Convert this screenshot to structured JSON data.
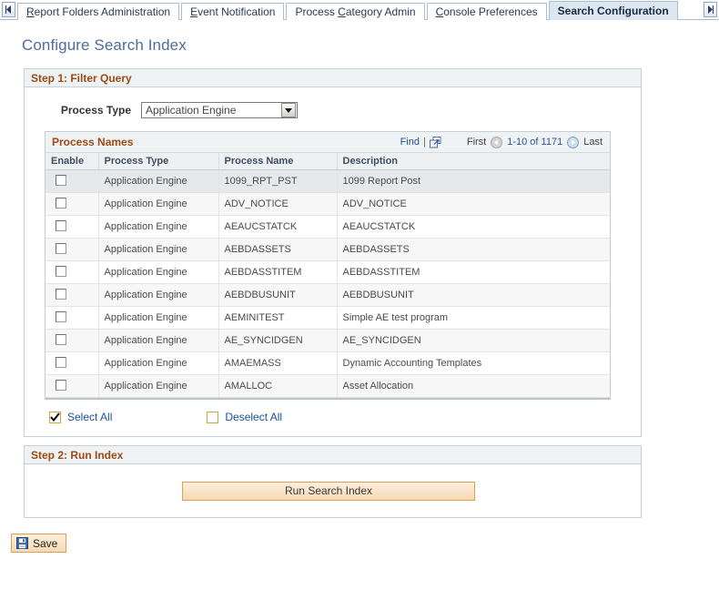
{
  "tabs": {
    "scroll_left_icon": "scroll-left-icon",
    "scroll_right_icon": "scroll-right-icon",
    "items": [
      {
        "label": "Report Folders Administration",
        "accel": "R",
        "active": false
      },
      {
        "label": "Event Notification",
        "accel": "E",
        "active": false
      },
      {
        "label": "Process Category Admin",
        "accel": "C",
        "active": false
      },
      {
        "label": "Console Preferences",
        "accel": "C",
        "active": false
      },
      {
        "label": "Search Configuration",
        "accel": "",
        "active": true
      }
    ]
  },
  "page": {
    "title": "Configure Search Index"
  },
  "step1": {
    "header": "Step 1: Filter Query",
    "process_type_label": "Process Type",
    "process_type_value": "Application Engine",
    "dropdown_icon": "chevron-down-icon"
  },
  "grid": {
    "title": "Process Names",
    "find_label": "Find",
    "separator": "|",
    "expand_icon": "view-all-expand-icon",
    "first_label": "First",
    "prev_icon": "prev-arrow-icon",
    "range_label": "1-10 of 1171",
    "next_icon": "next-arrow-icon",
    "last_label": "Last",
    "columns": [
      "Enable",
      "Process Type",
      "Process Name",
      "Description"
    ],
    "rows": [
      {
        "enabled": false,
        "process_type": "Application Engine",
        "process_name": "1099_RPT_PST",
        "description": "1099 Report Post"
      },
      {
        "enabled": false,
        "process_type": "Application Engine",
        "process_name": "ADV_NOTICE",
        "description": "ADV_NOTICE"
      },
      {
        "enabled": false,
        "process_type": "Application Engine",
        "process_name": "AEAUCSTATCK",
        "description": "AEAUCSTATCK"
      },
      {
        "enabled": false,
        "process_type": "Application Engine",
        "process_name": "AEBDASSETS",
        "description": "AEBDASSETS"
      },
      {
        "enabled": false,
        "process_type": "Application Engine",
        "process_name": "AEBDASSTITEM",
        "description": "AEBDASSTITEM"
      },
      {
        "enabled": false,
        "process_type": "Application Engine",
        "process_name": "AEBDBUSUNIT",
        "description": "AEBDBUSUNIT"
      },
      {
        "enabled": false,
        "process_type": "Application Engine",
        "process_name": "AEMINITEST",
        "description": "Simple AE test program"
      },
      {
        "enabled": false,
        "process_type": "Application Engine",
        "process_name": "AE_SYNCIDGEN",
        "description": "AE_SYNCIDGEN"
      },
      {
        "enabled": false,
        "process_type": "Application Engine",
        "process_name": "AMAEMASS",
        "description": "Dynamic Accounting Templates"
      },
      {
        "enabled": false,
        "process_type": "Application Engine",
        "process_name": "AMALLOC",
        "description": "Asset Allocation"
      }
    ]
  },
  "select_actions": {
    "select_all_label": "Select All",
    "select_all_checked": true,
    "deselect_all_label": "Deselect All",
    "deselect_all_checked": false
  },
  "step2": {
    "header": "Step 2: Run Index",
    "run_button_label": "Run Search Index"
  },
  "footer": {
    "save_label": "Save",
    "save_icon": "save-floppy-icon"
  },
  "colors": {
    "title_blue": "#4e6c9e",
    "section_orange": "#9c4a16",
    "link_blue": "#1a4f9c",
    "button_peach": "#f6d9b4",
    "panel_header_bg": "#eef2f3"
  }
}
